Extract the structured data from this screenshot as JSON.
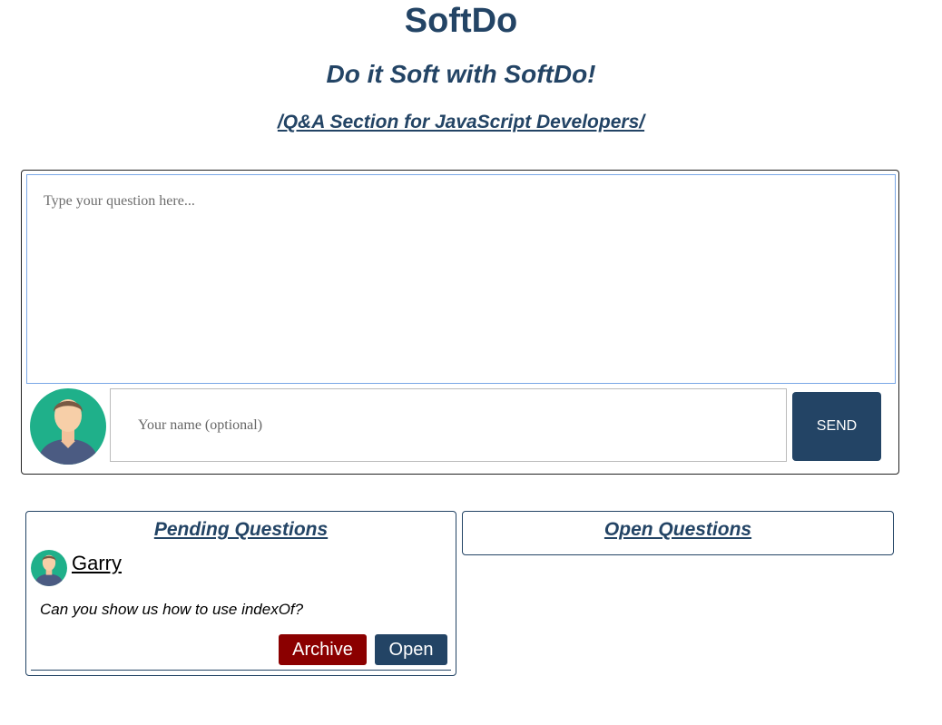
{
  "header": {
    "title": "SoftDo",
    "tagline": "Do it Soft with SoftDo!",
    "section_link": "/Q&A Section for JavaScript Developers/"
  },
  "ask_form": {
    "question_placeholder": "Type your question here...",
    "name_placeholder": "Your name (optional)",
    "send_label": "SEND"
  },
  "pending": {
    "title": "Pending Questions",
    "items": [
      {
        "name": "Garry",
        "question": "Can you show us how to use indexOf?",
        "archive_label": "Archive",
        "open_label": "Open"
      }
    ]
  },
  "open": {
    "title": "Open Questions"
  },
  "colors": {
    "primary": "#234465",
    "archive": "#8b0000",
    "avatar_bg": "#1fb08a"
  }
}
